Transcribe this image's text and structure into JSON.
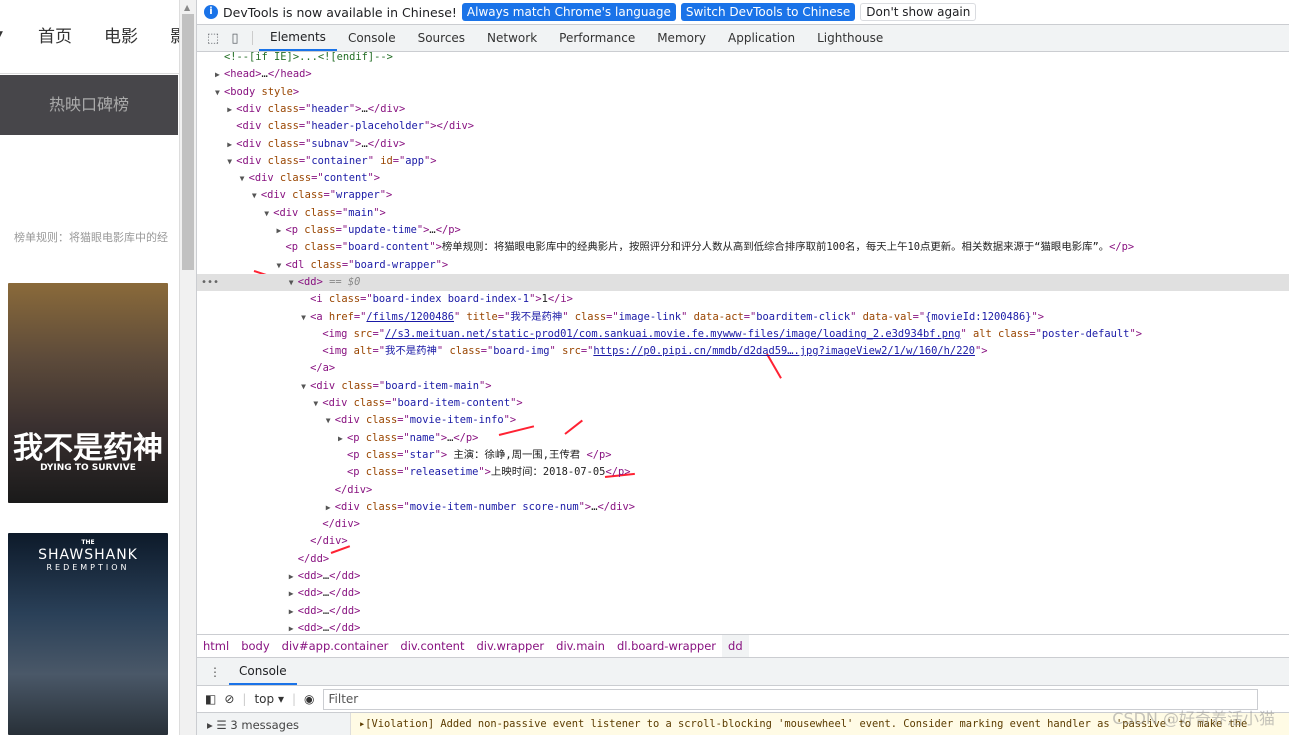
{
  "page": {
    "nav": [
      "首页",
      "电影",
      "影"
    ],
    "hot_board": "热映口碑榜",
    "rule_text": "榜单规则：将猫眼电影库中的经",
    "posters": [
      {
        "title": "我不是药神",
        "subtitle": "DYING TO SURVIVE"
      },
      {
        "title": "SHAWSHANK",
        "subtitle": "REDEMPTION",
        "pre": "THE"
      }
    ]
  },
  "devtools": {
    "infobar": {
      "message": "DevTools is now available in Chinese!",
      "btn_match": "Always match Chrome's language",
      "btn_switch": "Switch DevTools to Chinese",
      "btn_dismiss": "Don't show again"
    },
    "tabs": [
      "Elements",
      "Console",
      "Sources",
      "Network",
      "Performance",
      "Memory",
      "Application",
      "Lighthouse"
    ],
    "active_tab": "Elements",
    "tree": [
      {
        "l": 0,
        "a": "",
        "t": [
          [
            "cm",
            "<!--[if IE]>...<![endif]-->"
          ]
        ]
      },
      {
        "l": 0,
        "a": "c",
        "t": [
          [
            "tg",
            "<head>"
          ],
          [
            "tx",
            "…"
          ],
          [
            "tg",
            "</head>"
          ]
        ]
      },
      {
        "l": 0,
        "a": "o",
        "t": [
          [
            "tg",
            "<body "
          ],
          [
            "at",
            "style"
          ],
          [
            "tg",
            ">"
          ]
        ]
      },
      {
        "l": 1,
        "a": "c",
        "t": [
          [
            "tg",
            "<div "
          ],
          [
            "at",
            "class"
          ],
          [
            "tg",
            "=\""
          ],
          [
            "av",
            "header"
          ],
          [
            "tg",
            "\">"
          ],
          [
            "tx",
            "…"
          ],
          [
            "tg",
            "</div>"
          ]
        ]
      },
      {
        "l": 1,
        "a": "",
        "t": [
          [
            "tg",
            "<div "
          ],
          [
            "at",
            "class"
          ],
          [
            "tg",
            "=\""
          ],
          [
            "av",
            "header-placeholder"
          ],
          [
            "tg",
            "\"></div>"
          ]
        ]
      },
      {
        "l": 1,
        "a": "c",
        "t": [
          [
            "tg",
            "<div "
          ],
          [
            "at",
            "class"
          ],
          [
            "tg",
            "=\""
          ],
          [
            "av",
            "subnav"
          ],
          [
            "tg",
            "\">"
          ],
          [
            "tx",
            "…"
          ],
          [
            "tg",
            "</div>"
          ]
        ]
      },
      {
        "l": 1,
        "a": "o",
        "t": [
          [
            "tg",
            "<div "
          ],
          [
            "at",
            "class"
          ],
          [
            "tg",
            "=\""
          ],
          [
            "av",
            "container"
          ],
          [
            "tg",
            "\" "
          ],
          [
            "at",
            "id"
          ],
          [
            "tg",
            "=\""
          ],
          [
            "av",
            "app"
          ],
          [
            "tg",
            "\">"
          ]
        ]
      },
      {
        "l": 2,
        "a": "o",
        "t": [
          [
            "tg",
            "<div "
          ],
          [
            "at",
            "class"
          ],
          [
            "tg",
            "=\""
          ],
          [
            "av",
            "content"
          ],
          [
            "tg",
            "\">"
          ]
        ]
      },
      {
        "l": 3,
        "a": "o",
        "t": [
          [
            "tg",
            "<div "
          ],
          [
            "at",
            "class"
          ],
          [
            "tg",
            "=\""
          ],
          [
            "av",
            "wrapper"
          ],
          [
            "tg",
            "\">"
          ]
        ]
      },
      {
        "l": 4,
        "a": "o",
        "t": [
          [
            "tg",
            "<div "
          ],
          [
            "at",
            "class"
          ],
          [
            "tg",
            "=\""
          ],
          [
            "av",
            "main"
          ],
          [
            "tg",
            "\">"
          ]
        ]
      },
      {
        "l": 5,
        "a": "c",
        "t": [
          [
            "tg",
            "<p "
          ],
          [
            "at",
            "class"
          ],
          [
            "tg",
            "=\""
          ],
          [
            "av",
            "update-time"
          ],
          [
            "tg",
            "\">"
          ],
          [
            "tx",
            "…"
          ],
          [
            "tg",
            "</p>"
          ]
        ]
      },
      {
        "l": 5,
        "a": "",
        "t": [
          [
            "tg",
            "<p "
          ],
          [
            "at",
            "class"
          ],
          [
            "tg",
            "=\""
          ],
          [
            "av",
            "board-content"
          ],
          [
            "tg",
            "\">"
          ],
          [
            "tx",
            "榜单规则：将猫眼电影库中的经典影片，按照评分和评分人数从高到低综合排序取前100名，每天上午10点更新。相关数据来源于“猫眼电影库”。"
          ],
          [
            "tg",
            "</p>"
          ]
        ]
      },
      {
        "l": 5,
        "a": "o",
        "t": [
          [
            "tg",
            "<dl "
          ],
          [
            "at",
            "class"
          ],
          [
            "tg",
            "=\""
          ],
          [
            "av",
            "board-wrapper"
          ],
          [
            "tg",
            "\">"
          ]
        ]
      },
      {
        "l": 6,
        "a": "o",
        "sel": true,
        "t": [
          [
            "tg",
            "<dd>"
          ],
          [
            "eq",
            " == $0"
          ]
        ]
      },
      {
        "l": 7,
        "a": "",
        "t": [
          [
            "tg",
            "<i "
          ],
          [
            "at",
            "class"
          ],
          [
            "tg",
            "=\""
          ],
          [
            "av",
            "board-index board-index-1"
          ],
          [
            "tg",
            "\">"
          ],
          [
            "tx",
            "1"
          ],
          [
            "tg",
            "</i>"
          ]
        ]
      },
      {
        "l": 7,
        "a": "o",
        "t": [
          [
            "tg",
            "<a "
          ],
          [
            "at",
            "href"
          ],
          [
            "tg",
            "=\""
          ],
          [
            "lk",
            "/films/1200486"
          ],
          [
            "tg",
            "\" "
          ],
          [
            "at",
            "title"
          ],
          [
            "tg",
            "=\""
          ],
          [
            "av",
            "我不是药神"
          ],
          [
            "tg",
            "\" "
          ],
          [
            "at",
            "class"
          ],
          [
            "tg",
            "=\""
          ],
          [
            "av",
            "image-link"
          ],
          [
            "tg",
            "\" "
          ],
          [
            "at",
            "data-act"
          ],
          [
            "tg",
            "=\""
          ],
          [
            "av",
            "boarditem-click"
          ],
          [
            "tg",
            "\" "
          ],
          [
            "at",
            "data-val"
          ],
          [
            "tg",
            "=\""
          ],
          [
            "av",
            "{movieId:1200486}"
          ],
          [
            "tg",
            "\">"
          ]
        ]
      },
      {
        "l": 8,
        "a": "",
        "t": [
          [
            "tg",
            "<img "
          ],
          [
            "at",
            "src"
          ],
          [
            "tg",
            "=\""
          ],
          [
            "lk",
            "//s3.meituan.net/static-prod01/com.sankuai.movie.fe.mywww-files/image/loading_2.e3d934bf.png"
          ],
          [
            "tg",
            "\" "
          ],
          [
            "at",
            "alt class"
          ],
          [
            "tg",
            "=\""
          ],
          [
            "av",
            "poster-default"
          ],
          [
            "tg",
            "\">"
          ]
        ]
      },
      {
        "l": 8,
        "a": "",
        "t": [
          [
            "tg",
            "<img "
          ],
          [
            "at",
            "alt"
          ],
          [
            "tg",
            "=\""
          ],
          [
            "av",
            "我不是药神"
          ],
          [
            "tg",
            "\" "
          ],
          [
            "at",
            "class"
          ],
          [
            "tg",
            "=\""
          ],
          [
            "av",
            "board-img"
          ],
          [
            "tg",
            "\" "
          ],
          [
            "at",
            "src"
          ],
          [
            "tg",
            "=\""
          ],
          [
            "lk",
            "https://p0.pipi.cn/mmdb/d2dad59….jpg?imageView2/1/w/160/h/220"
          ],
          [
            "tg",
            "\">"
          ]
        ]
      },
      {
        "l": 7,
        "a": "",
        "t": [
          [
            "tg",
            "</a>"
          ]
        ]
      },
      {
        "l": 7,
        "a": "o",
        "t": [
          [
            "tg",
            "<div "
          ],
          [
            "at",
            "class"
          ],
          [
            "tg",
            "=\""
          ],
          [
            "av",
            "board-item-main"
          ],
          [
            "tg",
            "\">"
          ]
        ]
      },
      {
        "l": 8,
        "a": "o",
        "t": [
          [
            "tg",
            "<div "
          ],
          [
            "at",
            "class"
          ],
          [
            "tg",
            "=\""
          ],
          [
            "av",
            "board-item-content"
          ],
          [
            "tg",
            "\">"
          ]
        ]
      },
      {
        "l": 9,
        "a": "o",
        "t": [
          [
            "tg",
            "<div "
          ],
          [
            "at",
            "class"
          ],
          [
            "tg",
            "=\""
          ],
          [
            "av",
            "movie-item-info"
          ],
          [
            "tg",
            "\">"
          ]
        ]
      },
      {
        "l": 10,
        "a": "c",
        "t": [
          [
            "tg",
            "<p "
          ],
          [
            "at",
            "class"
          ],
          [
            "tg",
            "=\""
          ],
          [
            "av",
            "name"
          ],
          [
            "tg",
            "\">"
          ],
          [
            "tx",
            "…"
          ],
          [
            "tg",
            "</p>"
          ]
        ]
      },
      {
        "l": 10,
        "a": "",
        "t": [
          [
            "tg",
            "<p "
          ],
          [
            "at",
            "class"
          ],
          [
            "tg",
            "=\""
          ],
          [
            "av",
            "star"
          ],
          [
            "tg",
            "\">"
          ],
          [
            "tx",
            " 主演：徐峥,周一围,王传君 "
          ],
          [
            "tg",
            "</p>"
          ]
        ]
      },
      {
        "l": 10,
        "a": "",
        "t": [
          [
            "tg",
            "<p "
          ],
          [
            "at",
            "class"
          ],
          [
            "tg",
            "=\""
          ],
          [
            "av",
            "releasetime"
          ],
          [
            "tg",
            "\">"
          ],
          [
            "tx",
            "上映时间：2018-07-05"
          ],
          [
            "tg",
            "</p>"
          ]
        ]
      },
      {
        "l": 9,
        "a": "",
        "t": [
          [
            "tg",
            "</div>"
          ]
        ]
      },
      {
        "l": 9,
        "a": "c",
        "t": [
          [
            "tg",
            "<div "
          ],
          [
            "at",
            "class"
          ],
          [
            "tg",
            "=\""
          ],
          [
            "av",
            "movie-item-number score-num"
          ],
          [
            "tg",
            "\">"
          ],
          [
            "tx",
            "…"
          ],
          [
            "tg",
            "</div>"
          ]
        ]
      },
      {
        "l": 8,
        "a": "",
        "t": [
          [
            "tg",
            "</div>"
          ]
        ]
      },
      {
        "l": 7,
        "a": "",
        "t": [
          [
            "tg",
            "</div>"
          ]
        ]
      },
      {
        "l": 6,
        "a": "",
        "t": [
          [
            "tg",
            "</dd>"
          ]
        ]
      },
      {
        "l": 6,
        "a": "c",
        "t": [
          [
            "tg",
            "<dd>"
          ],
          [
            "tx",
            "…"
          ],
          [
            "tg",
            "</dd>"
          ]
        ]
      },
      {
        "l": 6,
        "a": "c",
        "t": [
          [
            "tg",
            "<dd>"
          ],
          [
            "tx",
            "…"
          ],
          [
            "tg",
            "</dd>"
          ]
        ]
      },
      {
        "l": 6,
        "a": "c",
        "t": [
          [
            "tg",
            "<dd>"
          ],
          [
            "tx",
            "…"
          ],
          [
            "tg",
            "</dd>"
          ]
        ]
      },
      {
        "l": 6,
        "a": "c",
        "t": [
          [
            "tg",
            "<dd>"
          ],
          [
            "tx",
            "…"
          ],
          [
            "tg",
            "</dd>"
          ]
        ]
      }
    ],
    "breadcrumbs": [
      "html",
      "body",
      "div#app.container",
      "div.content",
      "div.wrapper",
      "div.main",
      "dl.board-wrapper",
      "dd"
    ],
    "drawer_tab": "Console",
    "console": {
      "context": "top",
      "filter_placeholder": "Filter",
      "messages_count": "3 messages",
      "violation": "[Violation] Added non-passive event listener to a scroll-blocking 'mousewheel' event. Consider marking event handler as 'passive' to make the"
    }
  },
  "watermark": "CSDN @好奇养活小猫",
  "colors": {
    "accent": "#1a73e8",
    "annotation_arrow": "#ff2233"
  }
}
